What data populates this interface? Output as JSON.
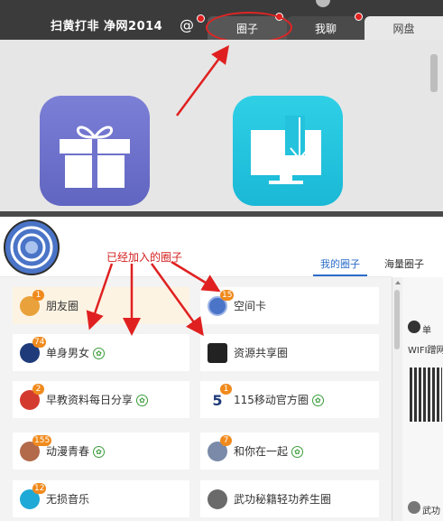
{
  "header": {
    "title": "扫黄打非 净网2014",
    "at_icon": "@",
    "tabs": [
      {
        "label": "圈子"
      },
      {
        "label": "我聊"
      },
      {
        "label": "网盘"
      }
    ]
  },
  "icons": {
    "gift": "gift-icon",
    "download": "download-screen-icon",
    "leaf": "leaf-icon"
  },
  "annotation": {
    "label": "已经加入的圈子"
  },
  "lower_tabs": [
    {
      "label": "我的圈子"
    },
    {
      "label": "海量圈子"
    }
  ],
  "circles": [
    {
      "label": "朋友圈",
      "badge": "1",
      "avatar_color": "#e9a23b",
      "verified": false
    },
    {
      "label": "空间卡",
      "badge": "15",
      "avatar_color": "#4a74c7",
      "verified": false
    },
    {
      "label": "单身男女",
      "badge": "74",
      "avatar_color": "#1f3b7a",
      "verified": true
    },
    {
      "label": "资源共享圈",
      "badge": "",
      "avatar_color": "#222222",
      "verified": false
    },
    {
      "label": "早教资料每日分享",
      "badge": "2",
      "avatar_color": "#d43b2f",
      "verified": true
    },
    {
      "label": "115移动官方圈",
      "badge": "1",
      "avatar_color": "#ffffff",
      "verified": true
    },
    {
      "label": "动漫青春",
      "badge": "155",
      "avatar_color": "#b26a4a",
      "verified": true
    },
    {
      "label": "和你在一起",
      "badge": "7",
      "avatar_color": "#7a8aa8",
      "verified": true
    },
    {
      "label": "无损音乐",
      "badge": "12",
      "avatar_color": "#1fa9d6",
      "verified": false
    },
    {
      "label": "武功秘籍轻功养生圈",
      "badge": "",
      "avatar_color": "#6a6a6a",
      "verified": false
    }
  ],
  "right_panel": {
    "name_fragment": "单",
    "wifi_text": "WIFI蹭网",
    "bottom_fragment": "武功"
  },
  "colors": {
    "annotation_red": "#e02020",
    "tab_active": "#2b6cc9",
    "badge_orange": "#f08a1c"
  }
}
